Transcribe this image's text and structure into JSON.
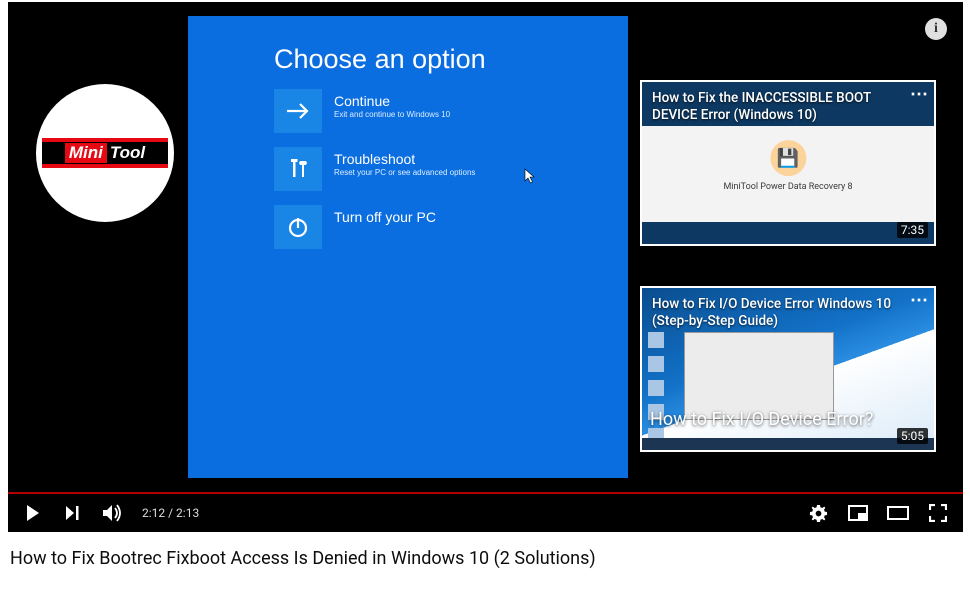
{
  "logo": {
    "part1": "Mini",
    "part2": "Tool"
  },
  "blue_screen": {
    "title": "Choose an option",
    "options": [
      {
        "label": "Continue",
        "desc": "Exit and continue to Windows 10"
      },
      {
        "label": "Troubleshoot",
        "desc": "Reset your PC or see advanced options"
      },
      {
        "label": "Turn off your PC",
        "desc": ""
      }
    ]
  },
  "endcards": [
    {
      "title": "How to Fix the INACCESSIBLE BOOT DEVICE Error (Windows 10)",
      "duration": "7:35",
      "thumb_caption": "MiniTool Power Data Recovery 8"
    },
    {
      "title": "How to Fix I/O Device Error Windows 10 (Step-by-Step Guide)",
      "duration": "5:05",
      "thumb_caption": "How to Fix I/O Device Error?"
    }
  ],
  "player": {
    "current_time": "2:12",
    "duration": "2:13"
  },
  "video_title": "How to Fix Bootrec Fixboot Access Is Denied in Windows 10 (2 Solutions)",
  "info": "i",
  "time_sep": " / "
}
